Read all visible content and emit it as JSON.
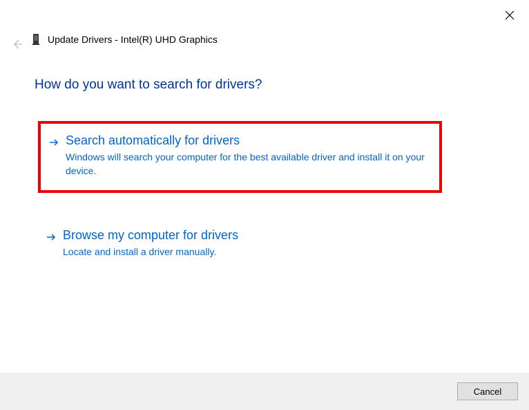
{
  "header": {
    "title": "Update Drivers - Intel(R) UHD Graphics"
  },
  "question": "How do you want to search for drivers?",
  "options": [
    {
      "title": "Search automatically for drivers",
      "description": "Windows will search your computer for the best available driver and install it on your device."
    },
    {
      "title": "Browse my computer for drivers",
      "description": "Locate and install a driver manually."
    }
  ],
  "footer": {
    "cancel_label": "Cancel"
  }
}
